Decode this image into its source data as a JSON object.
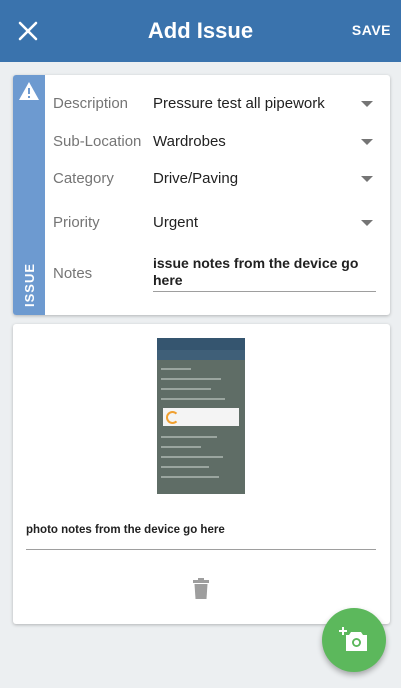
{
  "appbar": {
    "title": "Add Issue",
    "save_label": "SAVE",
    "background": "#3a73ad"
  },
  "issue_card": {
    "strip_label": "ISSUE",
    "strip_color": "#6d9ad0",
    "strip_icon": "warning-icon",
    "fields": [
      {
        "label": "Description",
        "value": "Pressure test all pipework"
      },
      {
        "label": "Sub-Location",
        "value": "Wardrobes"
      },
      {
        "label": "Category",
        "value": "Drive/Paving"
      },
      {
        "label": "Priority",
        "value": "Urgent"
      }
    ],
    "notes": {
      "label": "Notes",
      "value": "issue notes from the device go here"
    }
  },
  "photo_card": {
    "thumbnail_icon": "photo-thumbnail",
    "notes_value": "photo notes from the device go here",
    "delete_icon": "trash-icon"
  },
  "fab": {
    "icon": "add-photo-icon",
    "color": "#5cb85c"
  }
}
